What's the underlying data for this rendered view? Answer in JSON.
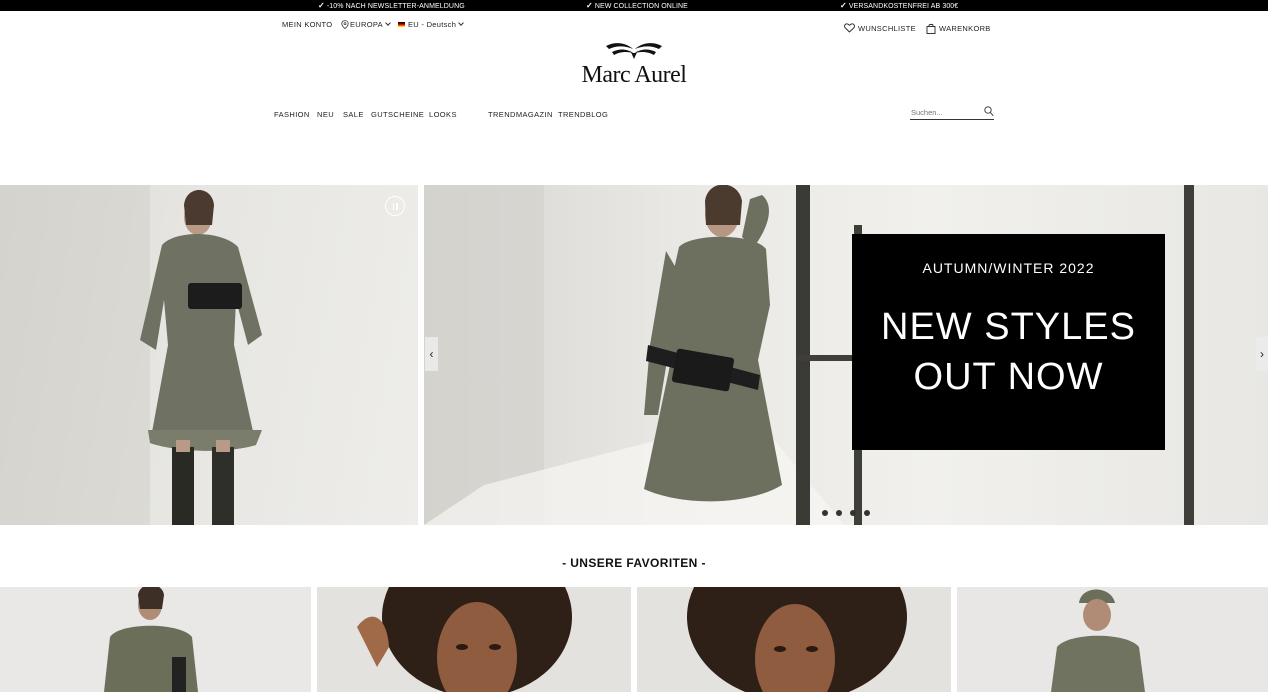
{
  "promo_bar": {
    "items": [
      "-10% NACH NEWSLETTER-ANMELDUNG",
      "NEW COLLECTION ONLINE",
      "VERSANDKOSTENFREI AB 300€"
    ]
  },
  "header": {
    "account": "MEIN KONTO",
    "region": "EUROPA",
    "language": "EU - Deutsch",
    "wishlist": "WUNSCHLISTE",
    "cart": "WARENKORB"
  },
  "logo": {
    "text": "Marc Aurel"
  },
  "nav": {
    "items": [
      "FASHION",
      "NEU",
      "SALE",
      "GUTSCHEINE",
      "LOOKS",
      "TRENDMAGAZIN",
      "TRENDBLOG"
    ]
  },
  "search": {
    "placeholder": "Suchen..."
  },
  "hero": {
    "subtitle": "AUTUMN/WINTER 2022",
    "headline_line1": "NEW STYLES",
    "headline_line2": "OUT NOW",
    "slide_count": 4,
    "prev_arrow": "‹",
    "next_arrow": "›"
  },
  "favorites": {
    "title": "- UNSERE FAVORITEN -"
  },
  "colors": {
    "promo_bg": "#000000",
    "promo_box_bg": "#000000",
    "text": "#111111"
  }
}
